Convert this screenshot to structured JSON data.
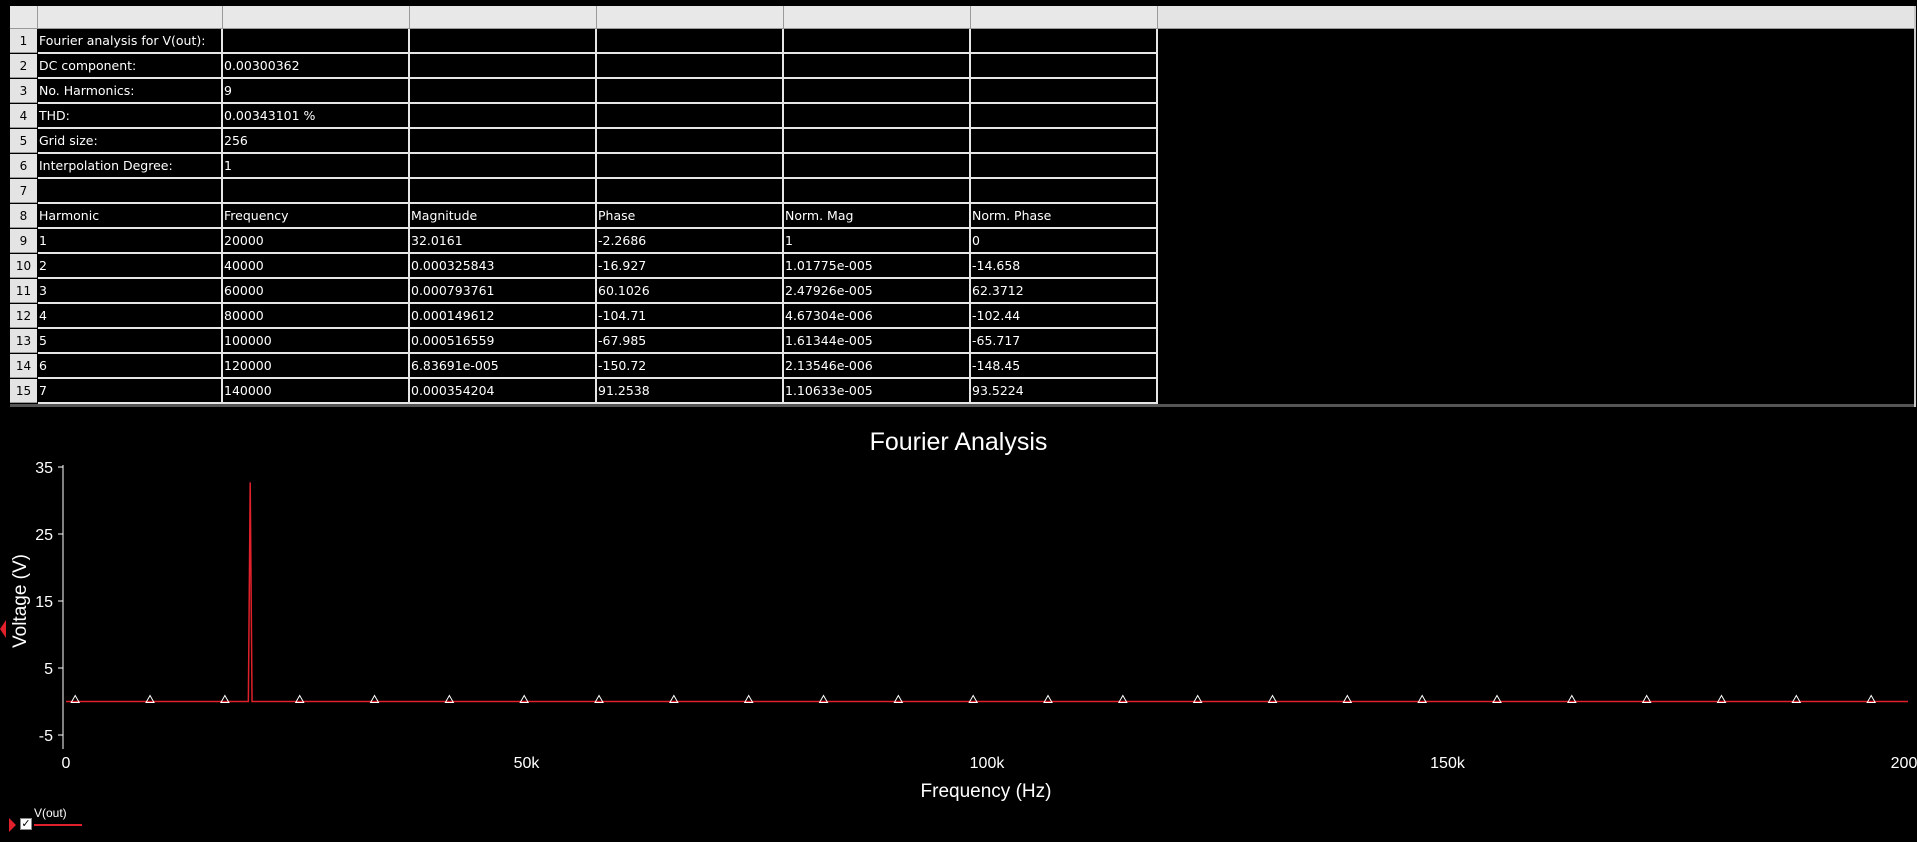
{
  "grid": {
    "row_numbers": [
      "1",
      "2",
      "3",
      "4",
      "5",
      "6",
      "7",
      "8",
      "9",
      "10",
      "11",
      "12",
      "13",
      "14",
      "15"
    ],
    "rows": [
      [
        "Fourier analysis for V(out):",
        "",
        "",
        "",
        "",
        ""
      ],
      [
        "DC component:",
        "0.00300362",
        "",
        "",
        "",
        ""
      ],
      [
        "No. Harmonics:",
        "9",
        "",
        "",
        "",
        ""
      ],
      [
        "THD:",
        "0.00343101 %",
        "",
        "",
        "",
        ""
      ],
      [
        "Grid size:",
        "256",
        "",
        "",
        "",
        ""
      ],
      [
        "Interpolation Degree:",
        "1",
        "",
        "",
        "",
        ""
      ],
      [
        "",
        "",
        "",
        "",
        "",
        ""
      ],
      [
        "Harmonic",
        "Frequency",
        "Magnitude",
        "Phase",
        "Norm. Mag",
        "Norm. Phase"
      ],
      [
        "1",
        "20000",
        "32.0161",
        "-2.2686",
        "1",
        "0"
      ],
      [
        "2",
        "40000",
        "0.000325843",
        "-16.927",
        "1.01775e-005",
        "-14.658"
      ],
      [
        "3",
        "60000",
        "0.000793761",
        "60.1026",
        "2.47926e-005",
        "62.3712"
      ],
      [
        "4",
        "80000",
        "0.000149612",
        "-104.71",
        "4.67304e-006",
        "-102.44"
      ],
      [
        "5",
        "100000",
        "0.000516559",
        "-67.985",
        "1.61344e-005",
        "-65.717"
      ],
      [
        "6",
        "120000",
        "6.83691e-005",
        "-150.72",
        "2.13546e-006",
        "-148.45"
      ],
      [
        "7",
        "140000",
        "0.000354204",
        "91.2538",
        "1.10633e-005",
        "93.5224"
      ]
    ]
  },
  "legend": {
    "label": "V(out)",
    "checkbox": "✓",
    "checked": true
  },
  "colors": {
    "trace": "#e0202a",
    "background": "#000000",
    "axis": "#ffffff"
  },
  "chart_data": {
    "type": "line",
    "title": "Fourier Analysis",
    "xlabel": "Frequency (Hz)",
    "ylabel": "Voltage (V)",
    "xlim": [
      0,
      200000
    ],
    "ylim": [
      -5,
      35
    ],
    "xticks": [
      {
        "value": 0,
        "label": "0"
      },
      {
        "value": 50000,
        "label": "50k"
      },
      {
        "value": 100000,
        "label": "100k"
      },
      {
        "value": 150000,
        "label": "150k"
      },
      {
        "value": 200000,
        "label": "200k"
      }
    ],
    "yticks": [
      {
        "value": 35,
        "label": "35"
      },
      {
        "value": 25,
        "label": "25"
      },
      {
        "value": 15,
        "label": "15"
      },
      {
        "value": 5,
        "label": "5"
      },
      {
        "value": -5,
        "label": "-5"
      }
    ],
    "grid": false,
    "series": [
      {
        "name": "V(out)",
        "points": [
          [
            0,
            0
          ],
          [
            19800,
            0
          ],
          [
            20000,
            32.7
          ],
          [
            20200,
            0
          ],
          [
            200000,
            0
          ]
        ],
        "markers_x": [
          1000,
          9125,
          17250,
          25375,
          33500,
          41625,
          49750,
          57875,
          66000,
          74125,
          82250,
          90375,
          98500,
          106625,
          114750,
          122875,
          131000,
          139125,
          147250,
          155375,
          163500,
          171625,
          179750,
          187875,
          196000
        ]
      }
    ]
  }
}
